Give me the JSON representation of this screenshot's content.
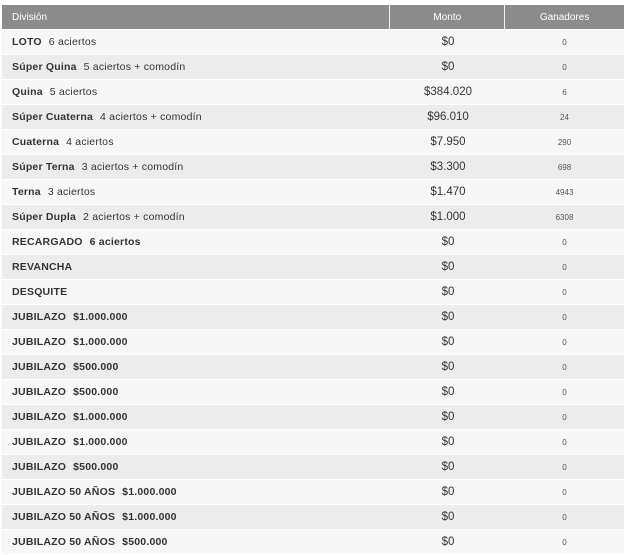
{
  "table": {
    "headers": {
      "division": "División",
      "monto": "Monto",
      "ganadores": "Ganadores"
    },
    "rows": [
      {
        "name": "LOTO",
        "detail": "6 aciertos",
        "monto": "$0",
        "ganadores": "0"
      },
      {
        "name": "Súper Quina",
        "detail": "5 aciertos + comodín",
        "monto": "$0",
        "ganadores": "0"
      },
      {
        "name": "Quina",
        "detail": "5 aciertos",
        "monto": "$384.020",
        "ganadores": "6"
      },
      {
        "name": "Súper Cuaterna",
        "detail": "4 aciertos + comodín",
        "monto": "$96.010",
        "ganadores": "24"
      },
      {
        "name": "Cuaterna",
        "detail": "4 aciertos",
        "monto": "$7.950",
        "ganadores": "290"
      },
      {
        "name": "Súper Terna",
        "detail": "3 aciertos + comodín",
        "monto": "$3.300",
        "ganadores": "698"
      },
      {
        "name": "Terna",
        "detail": "3 aciertos",
        "monto": "$1.470",
        "ganadores": "4943"
      },
      {
        "name": "Súper Dupla",
        "detail": "2 aciertos + comodín",
        "monto": "$1.000",
        "ganadores": "6308"
      },
      {
        "name": "RECARGADO",
        "detail": "6 aciertos",
        "monto": "$0",
        "ganadores": "0"
      },
      {
        "name": "REVANCHA",
        "detail": "",
        "monto": "$0",
        "ganadores": "0"
      },
      {
        "name": "DESQUITE",
        "detail": "",
        "monto": "$0",
        "ganadores": "0"
      },
      {
        "name": "JUBILAZO",
        "detail": "$1.000.000",
        "monto": "$0",
        "ganadores": "0"
      },
      {
        "name": "JUBILAZO",
        "detail": "$1.000.000",
        "monto": "$0",
        "ganadores": "0"
      },
      {
        "name": "JUBILAZO",
        "detail": "$500.000",
        "monto": "$0",
        "ganadores": "0"
      },
      {
        "name": "JUBILAZO",
        "detail": "$500.000",
        "monto": "$0",
        "ganadores": "0"
      },
      {
        "name": "JUBILAZO",
        "detail": "$1.000.000",
        "monto": "$0",
        "ganadores": "0"
      },
      {
        "name": "JUBILAZO",
        "detail": "$1.000.000",
        "monto": "$0",
        "ganadores": "0"
      },
      {
        "name": "JUBILAZO",
        "detail": "$500.000",
        "monto": "$0",
        "ganadores": "0"
      },
      {
        "name": "JUBILAZO 50 AÑOS",
        "detail": "$1.000.000",
        "monto": "$0",
        "ganadores": "0"
      },
      {
        "name": "JUBILAZO 50 AÑOS",
        "detail": "$1.000.000",
        "monto": "$0",
        "ganadores": "0"
      },
      {
        "name": "JUBILAZO 50 AÑOS",
        "detail": "$500.000",
        "monto": "$0",
        "ganadores": "0"
      }
    ]
  }
}
